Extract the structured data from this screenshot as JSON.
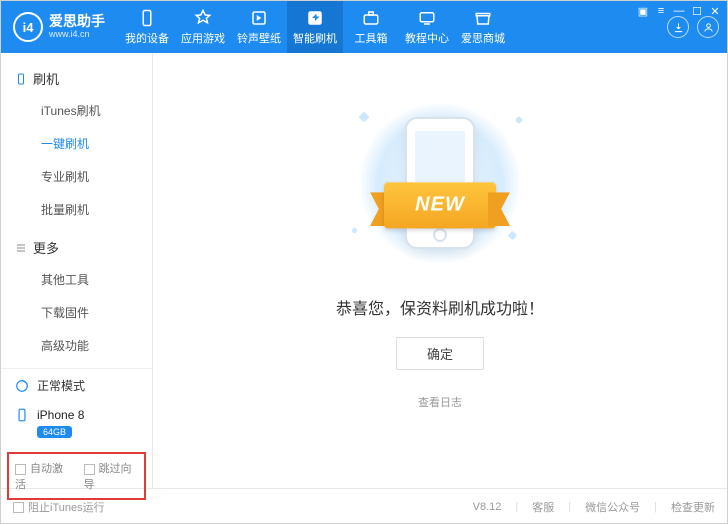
{
  "brand": {
    "name": "爱思助手",
    "url": "www.i4.cn",
    "logo_text": "i4"
  },
  "tabs": [
    {
      "label": "我的设备"
    },
    {
      "label": "应用游戏"
    },
    {
      "label": "铃声壁纸"
    },
    {
      "label": "智能刷机"
    },
    {
      "label": "工具箱"
    },
    {
      "label": "教程中心"
    },
    {
      "label": "爱思商城"
    }
  ],
  "sidebar": {
    "group1": {
      "title": "刷机",
      "items": [
        "iTunes刷机",
        "一键刷机",
        "专业刷机",
        "批量刷机"
      ]
    },
    "group2": {
      "title": "更多",
      "items": [
        "其他工具",
        "下载固件",
        "高级功能"
      ]
    },
    "mode": "正常模式",
    "device": {
      "name": "iPhone 8",
      "storage": "64GB"
    },
    "auto": {
      "opt1": "自动激活",
      "opt2": "跳过向导"
    }
  },
  "main": {
    "ribbon": "NEW",
    "success": "恭喜您，保资料刷机成功啦！",
    "ok": "确定",
    "log": "查看日志"
  },
  "footer": {
    "blockItunes": "阻止iTunes运行",
    "version": "V8.12",
    "kefu": "客服",
    "wechat": "微信公众号",
    "update": "检查更新"
  }
}
